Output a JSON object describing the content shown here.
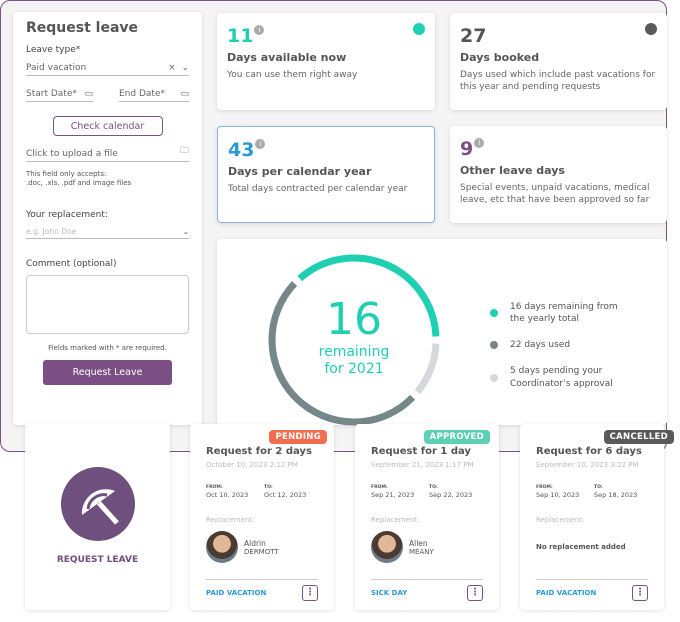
{
  "colors": {
    "accent": "#7b4f86",
    "teal": "#1ecfb2",
    "used": "#76878a",
    "pending": "#d4d9dc",
    "blue": "#2a9ad6",
    "pending_badge": "#f26d50",
    "approved_badge": "#5dcfb4",
    "cancelled_badge": "#5a5a5a"
  },
  "form": {
    "title": "Request leave",
    "leave_type_label": "Leave type*",
    "leave_type_value": "Paid vacation",
    "start_date_label": "Start Date*",
    "end_date_label": "End Date*",
    "check_calendar": "Check calendar",
    "upload_label": "Click to upload a file",
    "upload_hint_1": "This field only accepts:",
    "upload_hint_2": ".doc, .xls, .pdf and image files",
    "replacement_label": "Your replacement:",
    "replacement_placeholder": "e.g. John Doe",
    "comment_label": "Comment (optional)",
    "required_note": "Fields marked with * are required.",
    "submit": "Request Leave"
  },
  "stats": [
    {
      "value": "11",
      "title": "Days available now",
      "desc": "You can use them right away"
    },
    {
      "value": "27",
      "title": "Days booked",
      "desc": "Days used which include past vacations for this year and pending requests"
    },
    {
      "value": "43",
      "title": "Days per calendar year",
      "desc": "Total days contracted per calendar year"
    },
    {
      "value": "9",
      "title": "Other leave days",
      "desc": "Special events, unpaid vacations, medical leave, etc that have been approved so far"
    }
  ],
  "chart_data": {
    "type": "pie",
    "center_value": "16",
    "center_label_1": "remaining",
    "center_label_2": "for 2021",
    "series": [
      {
        "name": "16 days remaining from the yearly total",
        "value": 16,
        "color": "#1ecfb2"
      },
      {
        "name": "5 days pending your Coordinator’s approval",
        "value": 5,
        "color": "#d4d9dc"
      },
      {
        "name": "22 days used",
        "value": 22,
        "color": "#76878a"
      }
    ],
    "legend": [
      "16 days remaining from the yearly total",
      "22 days used",
      "5 days pending your Coordinator’s approval"
    ]
  },
  "request_tile": {
    "label": "REQUEST LEAVE",
    "icon": "umbrella-icon"
  },
  "requests": [
    {
      "status": "PENDING",
      "title": "Request for 2 days",
      "created": "October 10, 2023  2:12 PM",
      "from_label": "FROM:",
      "from": "Oct 10, 2023",
      "to_label": "TO:",
      "to": "Oct 12, 2023",
      "replacement_label": "Replacement:",
      "first": "Aldrin",
      "last": "DERMOTT",
      "type": "PAID VACATION"
    },
    {
      "status": "APPROVED",
      "title": "Request for 1 day",
      "created": "September 21, 2023  1:17 PM",
      "from_label": "FROM:",
      "from": "Sep 21, 2023",
      "to_label": "TO:",
      "to": "Sep 22, 2023",
      "replacement_label": "Replacement:",
      "first": "Allen",
      "last": "MEANY",
      "type": "SICK DAY"
    },
    {
      "status": "CANCELLED",
      "title": "Request for 6 days",
      "created": "September 10, 2023  3:22 PM",
      "from_label": "FROM:",
      "from": "Sep 10, 2023",
      "to_label": "TO:",
      "to": "Sep 18, 2023",
      "replacement_label": "Replacement:",
      "none": "No replacement added",
      "type": "PAID VACATION"
    }
  ]
}
